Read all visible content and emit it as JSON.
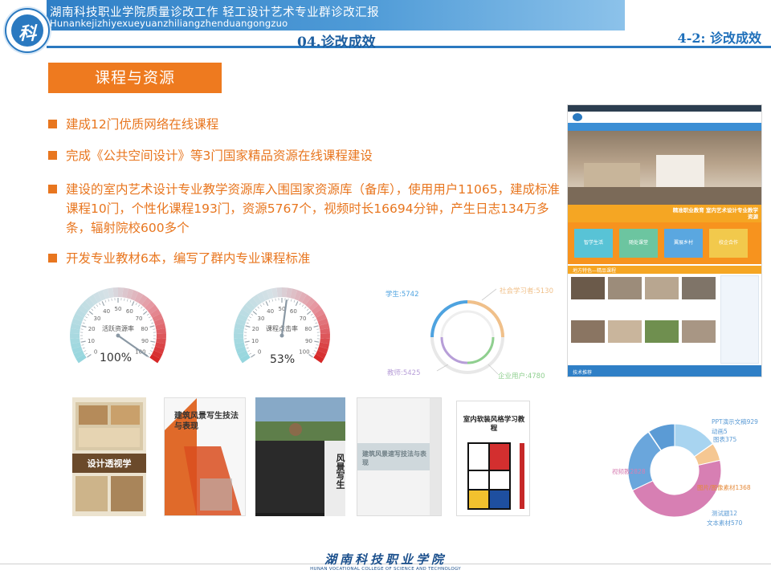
{
  "header": {
    "title_cn": "湖南科技职业学院质量诊改工作 轻工设计艺术专业群诊改汇报",
    "title_pinyin": "Hunankejizhiyexueyuanzhiliangzhenduangongzuo",
    "section": "04.诊改成效",
    "section_right": "4-2: 诊改成效"
  },
  "tag": "课程与资源",
  "bullets": [
    "建成12门优质网络在线课程",
    "完成《公共空间设计》等3门国家精品资源在线课程建设",
    "建设的室内艺术设计专业教学资源库入围国家资源库（备库），使用用户11065，建成标准课程10门，个性化课程193门，资源5767个，视频时长16694分钟，产生日志134万多条，辐射院校600多个",
    "开发专业教材6本，编写了群内专业课程标准"
  ],
  "gauges": [
    {
      "label": "活跃资源率",
      "value": 100,
      "display": "100%",
      "ticks": [
        "0",
        "10",
        "20",
        "30",
        "40",
        "50",
        "60",
        "70",
        "80",
        "90",
        "100"
      ]
    },
    {
      "label": "课程点击率",
      "value": 53,
      "display": "53%",
      "ticks": [
        "0",
        "10",
        "20",
        "30",
        "40",
        "50",
        "60",
        "70",
        "80",
        "90",
        "100"
      ]
    }
  ],
  "ring_chart": {
    "labels": [
      "学生:5742",
      "社会学习者:5130",
      "教师:5425",
      "企业用户:4780"
    ],
    "colors": [
      "#4ea3e0",
      "#f0c08a",
      "#b79ed8",
      "#8fcf8f"
    ]
  },
  "books": [
    {
      "title": "设计透视学"
    },
    {
      "title": "建筑风景写生技法与表现"
    },
    {
      "title": "风景写生"
    },
    {
      "title": "建筑风景速写技法与表现"
    },
    {
      "title": "室内软装风格学习教程"
    }
  ],
  "website": {
    "banner": "精准职业教育 室内艺术设计专业教学资源",
    "tiles": [
      "智学生活",
      "随处课堂",
      "翼展乡村",
      "校企合作"
    ],
    "section_title": "地方特色—精品课程",
    "footer": "技术推荐"
  },
  "donut": {
    "labels": [
      "PPT演示文稿929",
      "动画5",
      "图表375",
      "视频教2828",
      "图片/图像素材1368",
      "测试题12",
      "文本素材570"
    ],
    "colors": [
      "#a8d4f0",
      "#8fcf8f",
      "#f5c792",
      "#d77fb3",
      "#6aa6dc",
      "#9ed0e8",
      "#5b9bd5"
    ]
  },
  "footer": {
    "school_cn": "湖南科技职业学院",
    "school_en": "HUNAN VOCATIONAL COLLEGE OF SCIENCE AND TECHNOLOGY"
  }
}
